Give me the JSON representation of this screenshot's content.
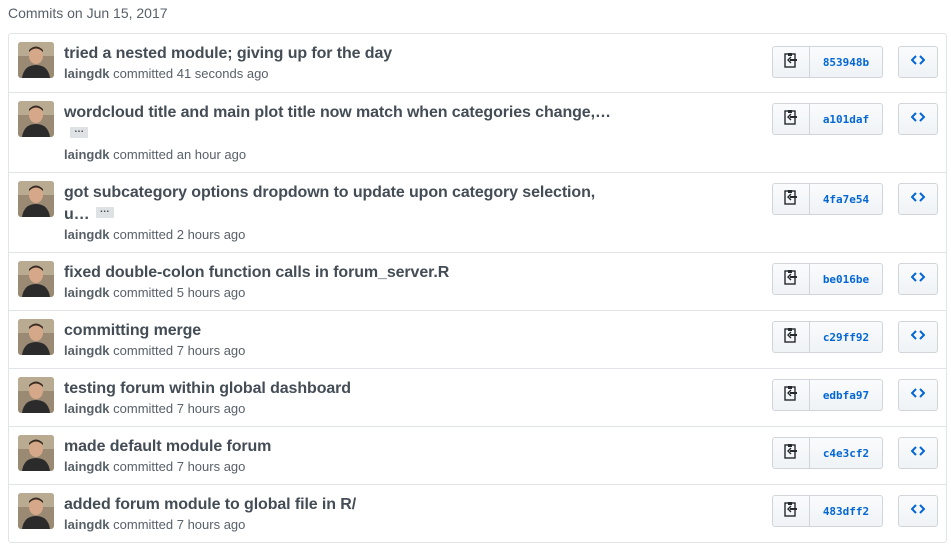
{
  "header": {
    "title": "Commits on Jun 15, 2017"
  },
  "colors": {
    "link_blue": "#0366d6",
    "title_gray": "#444d56",
    "meta_gray": "#586069",
    "border": "#e1e4e8"
  },
  "icons": {
    "copy": "clippy-icon",
    "browse": "code-icon",
    "avatar": "user-avatar"
  },
  "commits": [
    {
      "title": "tried a nested module; giving up for the day",
      "author": "laingdk",
      "verb": "committed",
      "time": "41 seconds ago",
      "sha": "853948b"
    },
    {
      "title_line1": "wordcloud title and main plot title now match when categories change,…",
      "ellipsis": "…",
      "author": "laingdk",
      "verb": "committed",
      "time": "an hour ago",
      "sha": "a101daf"
    },
    {
      "title_line1": "got subcategory options dropdown to update upon category selection,",
      "title_line2": "u…",
      "ellipsis": "…",
      "author": "laingdk",
      "verb": "committed",
      "time": "2 hours ago",
      "sha": "4fa7e54"
    },
    {
      "title": "fixed double-colon function calls in forum_server.R",
      "author": "laingdk",
      "verb": "committed",
      "time": "5 hours ago",
      "sha": "be016be"
    },
    {
      "title": "committing merge",
      "author": "laingdk",
      "verb": "committed",
      "time": "7 hours ago",
      "sha": "c29ff92"
    },
    {
      "title": "testing forum within global dashboard",
      "author": "laingdk",
      "verb": "committed",
      "time": "7 hours ago",
      "sha": "edbfa97"
    },
    {
      "title": "made default module forum",
      "author": "laingdk",
      "verb": "committed",
      "time": "7 hours ago",
      "sha": "c4e3cf2"
    },
    {
      "title": "added forum module to global file in R/",
      "author": "laingdk",
      "verb": "committed",
      "time": "7 hours ago",
      "sha": "483dff2"
    }
  ]
}
